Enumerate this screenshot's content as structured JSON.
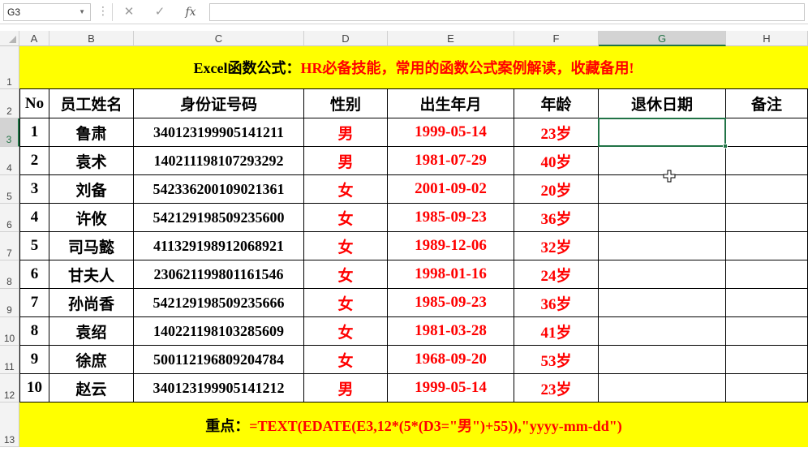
{
  "formula_bar": {
    "name_box": "G3",
    "cancel_icon": "✕",
    "enter_icon": "✓",
    "fx_label": "fx",
    "formula": ""
  },
  "columns": [
    "A",
    "B",
    "C",
    "D",
    "E",
    "F",
    "G",
    "H"
  ],
  "rows": [
    "1",
    "2",
    "3",
    "4",
    "5",
    "6",
    "7",
    "8",
    "9",
    "10",
    "11",
    "12",
    "13"
  ],
  "title": {
    "black_part": "Excel函数公式：",
    "red_part": "HR必备技能，常用的函数公式案例解读，收藏备用!"
  },
  "headers": [
    "No",
    "员工姓名",
    "身份证号码",
    "性别",
    "出生年月",
    "年龄",
    "退休日期",
    "备注"
  ],
  "records": [
    {
      "no": "1",
      "name": "鲁肃",
      "id": "340123199905141211",
      "gender": "男",
      "birth": "1999-05-14",
      "age": "23岁",
      "retire": "",
      "note": ""
    },
    {
      "no": "2",
      "name": "袁术",
      "id": "140211198107293292",
      "gender": "男",
      "birth": "1981-07-29",
      "age": "40岁",
      "retire": "",
      "note": ""
    },
    {
      "no": "3",
      "name": "刘备",
      "id": "542336200109021361",
      "gender": "女",
      "birth": "2001-09-02",
      "age": "20岁",
      "retire": "",
      "note": ""
    },
    {
      "no": "4",
      "name": "许攸",
      "id": "542129198509235600",
      "gender": "女",
      "birth": "1985-09-23",
      "age": "36岁",
      "retire": "",
      "note": ""
    },
    {
      "no": "5",
      "name": "司马懿",
      "id": "411329198912068921",
      "gender": "女",
      "birth": "1989-12-06",
      "age": "32岁",
      "retire": "",
      "note": ""
    },
    {
      "no": "6",
      "name": "甘夫人",
      "id": "230621199801161546",
      "gender": "女",
      "birth": "1998-01-16",
      "age": "24岁",
      "retire": "",
      "note": ""
    },
    {
      "no": "7",
      "name": "孙尚香",
      "id": "542129198509235666",
      "gender": "女",
      "birth": "1985-09-23",
      "age": "36岁",
      "retire": "",
      "note": ""
    },
    {
      "no": "8",
      "name": "袁绍",
      "id": "140221198103285609",
      "gender": "女",
      "birth": "1981-03-28",
      "age": "41岁",
      "retire": "",
      "note": ""
    },
    {
      "no": "9",
      "name": "徐庶",
      "id": "500112196809204784",
      "gender": "女",
      "birth": "1968-09-20",
      "age": "53岁",
      "retire": "",
      "note": ""
    },
    {
      "no": "10",
      "name": "赵云",
      "id": "340123199905141212",
      "gender": "男",
      "birth": "1999-05-14",
      "age": "23岁",
      "retire": "",
      "note": ""
    }
  ],
  "footer": {
    "black_part": "重点：",
    "red_part": "=TEXT(EDATE(E3,12*(5*(D3=\"男\")+55)),\"yyyy-mm-dd\")"
  },
  "selected_cell": "G3",
  "colors": {
    "banner": "#ffff00",
    "accent_text": "#ff0000",
    "selection": "#217346"
  }
}
